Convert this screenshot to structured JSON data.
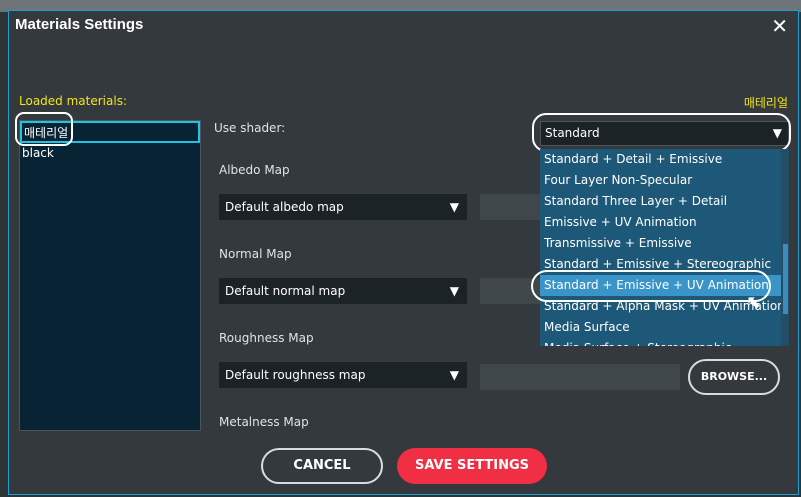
{
  "dialog": {
    "title": "Materials Settings",
    "close_glyph": "✕"
  },
  "materials": {
    "label": "Loaded materials:",
    "selected_name": "매테리얼",
    "items": [
      "매테리얼",
      "black"
    ]
  },
  "shader": {
    "label": "Use shader:",
    "selected": "Standard",
    "options": [
      "Standard + Detail + Emissive",
      "Four Layer Non-Specular",
      "Standard Three Layer + Detail",
      "Emissive + UV Animation",
      "Transmissive + Emissive",
      "Standard + Emissive + Stereographic",
      "Standard + Emissive + UV Animation",
      "Standard + Alpha Mask + UV Animation",
      "Media Surface",
      "Media Surface + Stereographic"
    ],
    "highlighted_index": 6
  },
  "maps": {
    "albedo": {
      "label": "Albedo Map",
      "value": "Default albedo map"
    },
    "normal": {
      "label": "Normal Map",
      "value": "Default normal map"
    },
    "roughness": {
      "label": "Roughness Map",
      "value": "Default roughness map"
    },
    "metalness": {
      "label": "Metalness Map"
    }
  },
  "buttons": {
    "browse": "BROWSE...",
    "cancel": "CANCEL",
    "save": "SAVE SETTINGS"
  },
  "icons": {
    "dropdown_arrow": "▼",
    "cursor": "⬉"
  },
  "colors": {
    "accent": "#1f9fd0",
    "warning_text": "#f1e51c",
    "save_button": "#f02e44",
    "highlight_item": "#3a94c8"
  }
}
